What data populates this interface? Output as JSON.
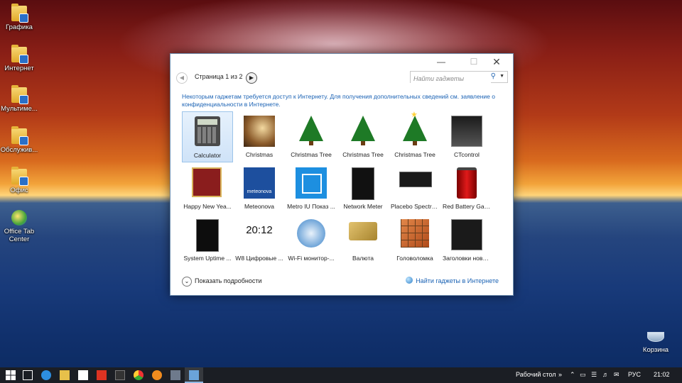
{
  "desktop": {
    "icons": [
      {
        "label": "Графика"
      },
      {
        "label": "Интернет"
      },
      {
        "label": "Мультиме..."
      },
      {
        "label": "Обслужив..."
      },
      {
        "label": "Офис"
      },
      {
        "label": "Office Tab Center"
      }
    ],
    "recycle_bin": "Корзина"
  },
  "dialog": {
    "page_label": "Страница 1 из 2",
    "search_placeholder": "Найти гаджеты",
    "notice": "Некоторым гаджетам требуется доступ к Интернету. Для получения дополнительных сведений см. заявление о конфиденциальности в Интернете.",
    "gadgets": [
      {
        "label": "Calculator"
      },
      {
        "label": "Christmas"
      },
      {
        "label": "Christmas Tree"
      },
      {
        "label": "Christmas Tree"
      },
      {
        "label": "Christmas Tree"
      },
      {
        "label": "CTcontrol"
      },
      {
        "label": "Happy New Yea..."
      },
      {
        "label": "Meteonova"
      },
      {
        "label": "Metro IU Показ ..."
      },
      {
        "label": "Network Meter"
      },
      {
        "label": "Placebo Spectru..."
      },
      {
        "label": "Red Battery Gau..."
      },
      {
        "label": "System Uptime ..."
      },
      {
        "label": "W8 Цифровые ..."
      },
      {
        "label": "Wi-Fi монитор-..."
      },
      {
        "label": "Валюта"
      },
      {
        "label": "Головоломка"
      },
      {
        "label": "Заголовки новo..."
      }
    ],
    "meteo_text": "meteonova",
    "w8_time": "20:12",
    "show_details": "Показать подробности",
    "find_online": "Найти гаджеты в Интернете"
  },
  "taskbar": {
    "desktop_label": "Рабочий стол",
    "lang": "РУС",
    "clock": "21:02"
  }
}
